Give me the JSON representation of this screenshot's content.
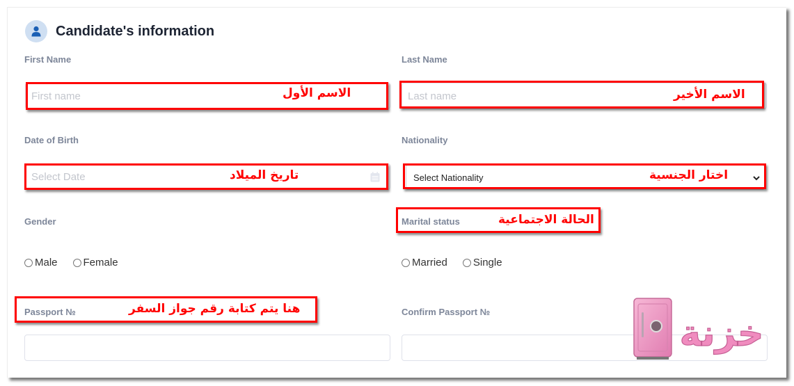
{
  "section": {
    "title": "Candidate's information",
    "icon": "user-icon"
  },
  "fields": {
    "first_name": {
      "label": "First Name",
      "placeholder": "First name",
      "annotation": "الاسم الأول"
    },
    "last_name": {
      "label": "Last Name",
      "placeholder": "Last name",
      "annotation": "الاسم الأخير"
    },
    "dob": {
      "label": "Date of Birth",
      "placeholder": "Select Date",
      "annotation": "تاريخ الميلاد",
      "icon": "calendar-icon"
    },
    "nationality": {
      "label": "Nationality",
      "selected": "Select Nationality",
      "annotation": "اختار الجنسية"
    },
    "gender": {
      "label": "Gender",
      "options": [
        "Male",
        "Female"
      ]
    },
    "marital_status": {
      "label": "Marital status",
      "options": [
        "Married",
        "Single"
      ],
      "annotation": "الحالة الاجتماعية"
    },
    "passport": {
      "label": "Passport №",
      "value": "",
      "annotation": "هنا يتم كتابة رقم جواز السفر"
    },
    "confirm_passport": {
      "label": "Confirm Passport №",
      "value": ""
    }
  },
  "watermark": {
    "text": "خزنة",
    "icon": "safe-icon"
  },
  "colors": {
    "annotation": "#ff0000",
    "label": "#7d8699",
    "icon_accent": "#1a5fb4",
    "icon_bg": "#cfdff2",
    "watermark": "#f08cbf"
  }
}
